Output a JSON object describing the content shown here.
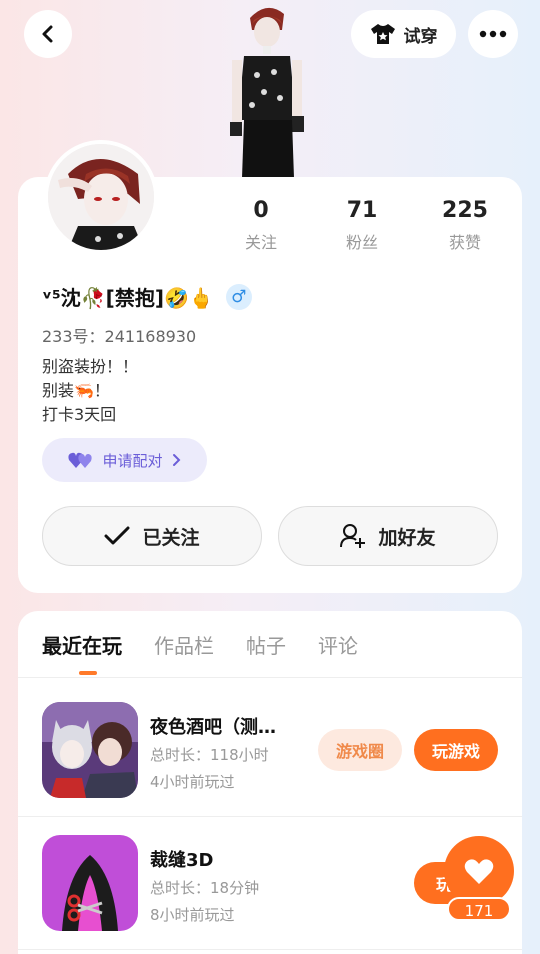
{
  "header": {
    "tryon_label": "试穿",
    "icons": [
      "back-icon",
      "shirt-icon",
      "more-icon"
    ]
  },
  "profile": {
    "name": "ᵛ⁵沈🥀[禁抱]🤣🖕",
    "gender_symbol": "♂",
    "uid": "233号：241168930",
    "bio": [
      "别盗装扮！！",
      "别装🦐！",
      "打卡3天回"
    ],
    "pair_label": "申请配对"
  },
  "stats": [
    {
      "num": "0",
      "label": "关注"
    },
    {
      "num": "71",
      "label": "粉丝"
    },
    {
      "num": "225",
      "label": "获赞"
    }
  ],
  "actions": {
    "follow_label": "已关注",
    "add_friend_label": "加好友"
  },
  "tabs": [
    "最近在玩",
    "作品栏",
    "帖子",
    "评论"
  ],
  "games": [
    {
      "title": "夜色酒吧（测…",
      "duration": "总时长：118小时",
      "last_played": "4小时前玩过",
      "circle_label": "游戏圈",
      "play_label": "玩游戏"
    },
    {
      "title": "裁缝3D",
      "duration": "总时长：18分钟",
      "last_played": "8小时前玩过",
      "play_label": "玩"
    }
  ],
  "like": {
    "count": "171"
  },
  "colors": {
    "accent": "#ff6f1f",
    "pair": "#6b5ed8"
  }
}
